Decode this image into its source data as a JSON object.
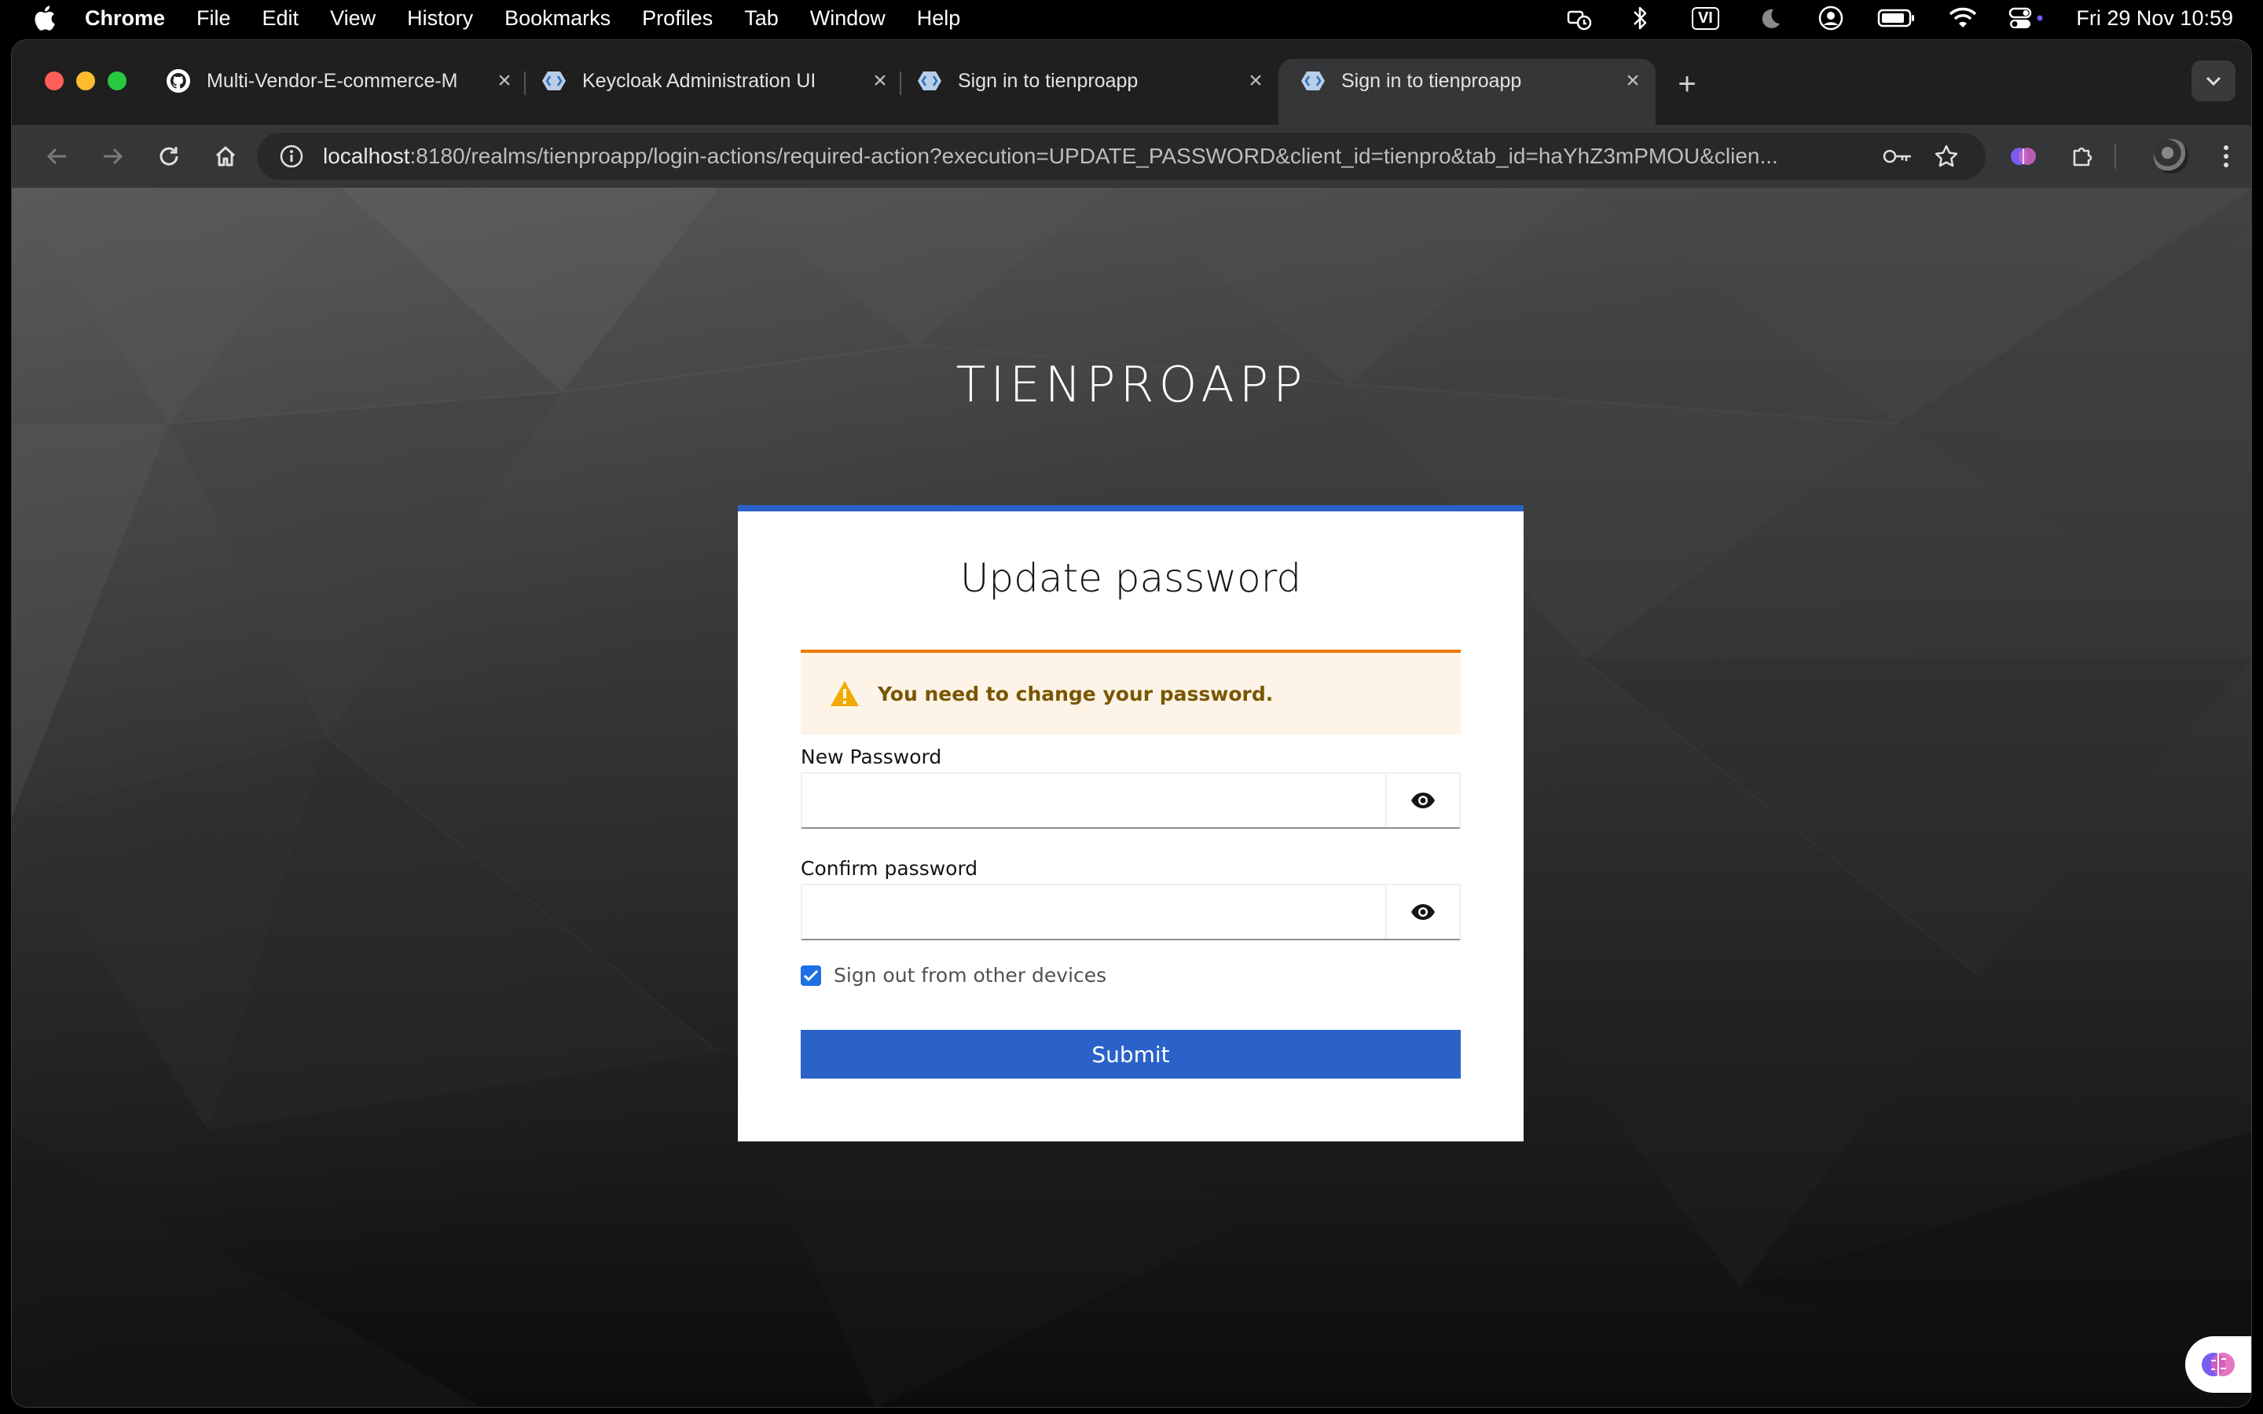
{
  "menubar": {
    "app_name": "Chrome",
    "items": [
      "File",
      "Edit",
      "View",
      "History",
      "Bookmarks",
      "Profiles",
      "Tab",
      "Window",
      "Help"
    ],
    "clock": "Fri 29 Nov  10:59",
    "status_icons": [
      "timer-icon",
      "bluetooth-icon",
      "input-source-icon",
      "do-not-disturb-icon",
      "user-icon",
      "battery-icon",
      "wifi-icon",
      "control-center-icon"
    ],
    "input_source": "VI"
  },
  "browser": {
    "tabs": [
      {
        "title": "Multi-Vendor-E-commerce-M",
        "favicon": "github-icon",
        "active": false
      },
      {
        "title": "Keycloak Administration UI",
        "favicon": "keycloak-icon",
        "active": false
      },
      {
        "title": "Sign in to tienproapp",
        "favicon": "keycloak-icon",
        "active": false
      },
      {
        "title": "Sign in to tienproapp",
        "favicon": "keycloak-icon",
        "active": true
      }
    ],
    "url_host": "localhost",
    "url_rest": ":8180/realms/tienproapp/login-actions/required-action?execution=UPDATE_PASSWORD&client_id=tienpro&tab_id=haYhZ3mPMOU&clien..."
  },
  "page": {
    "realm_title": "TIENPROAPP",
    "card_title": "Update password",
    "alert": {
      "text": "You need to change your password.",
      "color": "#ec7a08"
    },
    "new_password": {
      "label": "New Password",
      "value": ""
    },
    "confirm_password": {
      "label": "Confirm password",
      "value": ""
    },
    "sign_out_checkbox": {
      "label": "Sign out from other devices",
      "checked": true
    },
    "submit_label": "Submit",
    "accent_color": "#2a62c9"
  }
}
